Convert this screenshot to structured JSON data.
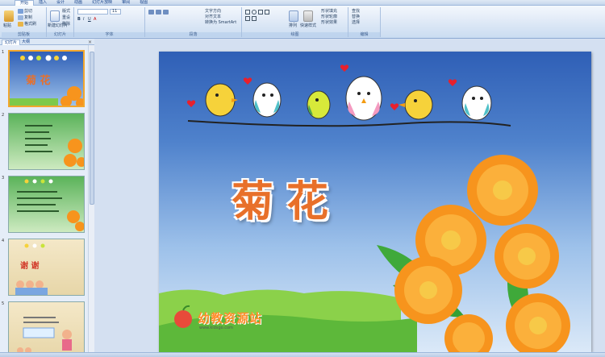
{
  "ribbon": {
    "tabs": [
      "开始",
      "插入",
      "设计",
      "动画",
      "幻灯片放映",
      "审阅",
      "视图"
    ],
    "groups": [
      "剪贴板",
      "幻灯片",
      "字体",
      "段落",
      "绘图",
      "编辑"
    ],
    "clipboard": {
      "paste": "粘贴",
      "cut": "剪切",
      "copy": "复制",
      "format_painter": "格式刷"
    },
    "slides": {
      "new_slide": "新建幻灯片",
      "layout": "版式",
      "reset": "重设",
      "delete": "删除"
    },
    "font": {
      "size": "11"
    },
    "paragraph": {
      "text_direction": "文字方向",
      "align_text": "对齐文本",
      "smartart": "转换为 SmartArt"
    },
    "drawing": {
      "arrange": "排列",
      "quick_styles": "快速样式",
      "shape_fill": "形状填充",
      "shape_outline": "形状轮廓",
      "shape_effects": "形状效果"
    },
    "editing": {
      "find": "查找",
      "replace": "替换",
      "select": "选择"
    }
  },
  "pane": {
    "tabs": [
      "幻灯片",
      "大纲"
    ],
    "slide_numbers": [
      "1",
      "2",
      "3",
      "4",
      "5"
    ],
    "slide4_text": "谢 谢"
  },
  "slide": {
    "title": "菊花",
    "logo": "幼教资源站",
    "logo_url": "www.kidsgo.com"
  },
  "colors": {
    "title_orange": "#e8702a",
    "ribbon_blue": "#cadcf1",
    "flower_orange": "#f7941d"
  }
}
